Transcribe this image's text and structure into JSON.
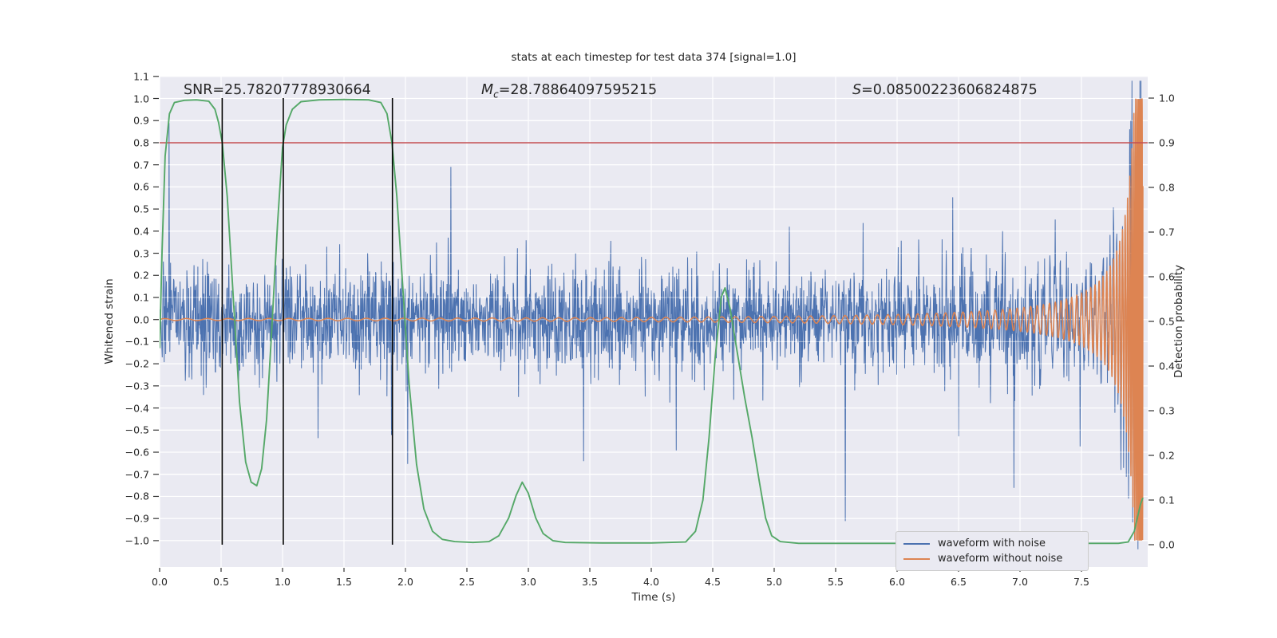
{
  "figure": {
    "title": "stats at each timestep for test data 374 [signal=1.0]",
    "xlabel": "Time (s)",
    "ylabel_left": "Whitened strain",
    "ylabel_right": "Detection probability",
    "annotations": {
      "snr": "SNR=25.78207778930664",
      "mc_var": "M",
      "mc_sub": "c",
      "mc_rest": "=28.78864097595215",
      "s_var": "S",
      "s_rest": "=0.08500223606824875"
    },
    "legend": {
      "items": [
        {
          "label": "waveform with noise",
          "color": "#4c72b0"
        },
        {
          "label": "waveform without noise",
          "color": "#dd8452"
        }
      ]
    }
  },
  "chart_data": {
    "type": "line",
    "title": "stats at each timestep for test data 374 [signal=1.0]",
    "xlabel": "Time (s)",
    "ylabel_left": "Whitened strain",
    "ylabel_right": "Detection probability",
    "stats": {
      "SNR": 25.78207778930664,
      "Mc": 28.78864097595215,
      "S": 0.08500223606824875
    },
    "x_axis": {
      "lim": [
        0,
        8.04
      ],
      "ticks": [
        0.0,
        0.5,
        1.0,
        1.5,
        2.0,
        2.5,
        3.0,
        3.5,
        4.0,
        4.5,
        5.0,
        5.5,
        6.0,
        6.5,
        7.0,
        7.5
      ]
    },
    "left_axis": {
      "lim": [
        -1.12,
        1.1
      ],
      "ticks": [
        1.1,
        1.0,
        0.9,
        0.8,
        0.7,
        0.6,
        0.5,
        0.4,
        0.3,
        0.2,
        0.1,
        0.0,
        -0.1,
        -0.2,
        -0.3,
        -0.4,
        -0.5,
        -0.6,
        -0.7,
        -0.8,
        -0.9,
        -1.0
      ]
    },
    "right_axis": {
      "lim": [
        -0.05,
        1.05
      ],
      "ticks": [
        1.0,
        0.9,
        0.8,
        0.7,
        0.6,
        0.5,
        0.4,
        0.3,
        0.2,
        0.1,
        0.0
      ]
    },
    "grid": true,
    "plot_bg": "#eaeaf2",
    "grid_color": "#ffffff",
    "threshold_line": {
      "axis": "right",
      "value": 0.9,
      "color": "#c44e52"
    },
    "event_lines": {
      "times": [
        0.509,
        1.006,
        1.894
      ],
      "color": "#000000",
      "span_right_axis": [
        0.0,
        1.0
      ]
    },
    "series": [
      {
        "name": "waveform with noise",
        "color": "#4c72b0",
        "axis": "left",
        "kind": "noise_plus_chirp",
        "n_samples": 2600,
        "t_max": 8.0,
        "noise_std": 0.115,
        "tail_prob": 0.04,
        "seed": 374,
        "end_spike": {
          "t": 7.9,
          "value": 0.9
        }
      },
      {
        "name": "waveform without noise",
        "color": "#dd8452",
        "axis": "left",
        "kind": "chirp",
        "t_max": 8.0,
        "amp0": 0.012,
        "t_ref": 8.02,
        "tau": 3.52,
        "amp_exp": 1.2,
        "f0": 9.0,
        "f_exp": 0.55,
        "clip": 1.0
      },
      {
        "name": "detection probability",
        "color": "#55a868",
        "axis": "right",
        "kind": "keypoints",
        "points": [
          [
            0,
            0.44
          ],
          [
            0.02,
            0.66
          ],
          [
            0.045,
            0.87
          ],
          [
            0.08,
            0.965
          ],
          [
            0.12,
            0.99
          ],
          [
            0.2,
            0.995
          ],
          [
            0.3,
            0.996
          ],
          [
            0.4,
            0.993
          ],
          [
            0.45,
            0.975
          ],
          [
            0.48,
            0.945
          ],
          [
            0.51,
            0.9
          ],
          [
            0.55,
            0.78
          ],
          [
            0.6,
            0.55
          ],
          [
            0.65,
            0.32
          ],
          [
            0.7,
            0.185
          ],
          [
            0.745,
            0.14
          ],
          [
            0.79,
            0.132
          ],
          [
            0.83,
            0.17
          ],
          [
            0.87,
            0.28
          ],
          [
            0.91,
            0.47
          ],
          [
            0.96,
            0.72
          ],
          [
            1.0,
            0.89
          ],
          [
            1.03,
            0.94
          ],
          [
            1.08,
            0.975
          ],
          [
            1.15,
            0.992
          ],
          [
            1.3,
            0.996
          ],
          [
            1.5,
            0.997
          ],
          [
            1.7,
            0.996
          ],
          [
            1.8,
            0.99
          ],
          [
            1.85,
            0.965
          ],
          [
            1.89,
            0.9
          ],
          [
            1.93,
            0.78
          ],
          [
            1.98,
            0.57
          ],
          [
            2.03,
            0.36
          ],
          [
            2.09,
            0.18
          ],
          [
            2.15,
            0.08
          ],
          [
            2.22,
            0.03
          ],
          [
            2.3,
            0.012
          ],
          [
            2.4,
            0.007
          ],
          [
            2.55,
            0.005
          ],
          [
            2.68,
            0.007
          ],
          [
            2.76,
            0.02
          ],
          [
            2.84,
            0.06
          ],
          [
            2.9,
            0.11
          ],
          [
            2.95,
            0.14
          ],
          [
            3.0,
            0.115
          ],
          [
            3.06,
            0.06
          ],
          [
            3.12,
            0.025
          ],
          [
            3.2,
            0.009
          ],
          [
            3.3,
            0.005
          ],
          [
            3.6,
            0.004
          ],
          [
            4.0,
            0.004
          ],
          [
            4.28,
            0.006
          ],
          [
            4.36,
            0.03
          ],
          [
            4.42,
            0.1
          ],
          [
            4.47,
            0.24
          ],
          [
            4.52,
            0.42
          ],
          [
            4.57,
            0.555
          ],
          [
            4.6,
            0.575
          ],
          [
            4.64,
            0.53
          ],
          [
            4.7,
            0.43
          ],
          [
            4.76,
            0.33
          ],
          [
            4.82,
            0.24
          ],
          [
            4.88,
            0.14
          ],
          [
            4.93,
            0.06
          ],
          [
            4.98,
            0.02
          ],
          [
            5.05,
            0.007
          ],
          [
            5.2,
            0.003
          ],
          [
            5.6,
            0.003
          ],
          [
            6.0,
            0.003
          ],
          [
            6.5,
            0.003
          ],
          [
            7.0,
            0.003
          ],
          [
            7.4,
            0.003
          ],
          [
            7.8,
            0.003
          ],
          [
            7.88,
            0.006
          ],
          [
            7.93,
            0.03
          ],
          [
            7.98,
            0.09
          ],
          [
            8.0,
            0.105
          ]
        ]
      }
    ]
  }
}
